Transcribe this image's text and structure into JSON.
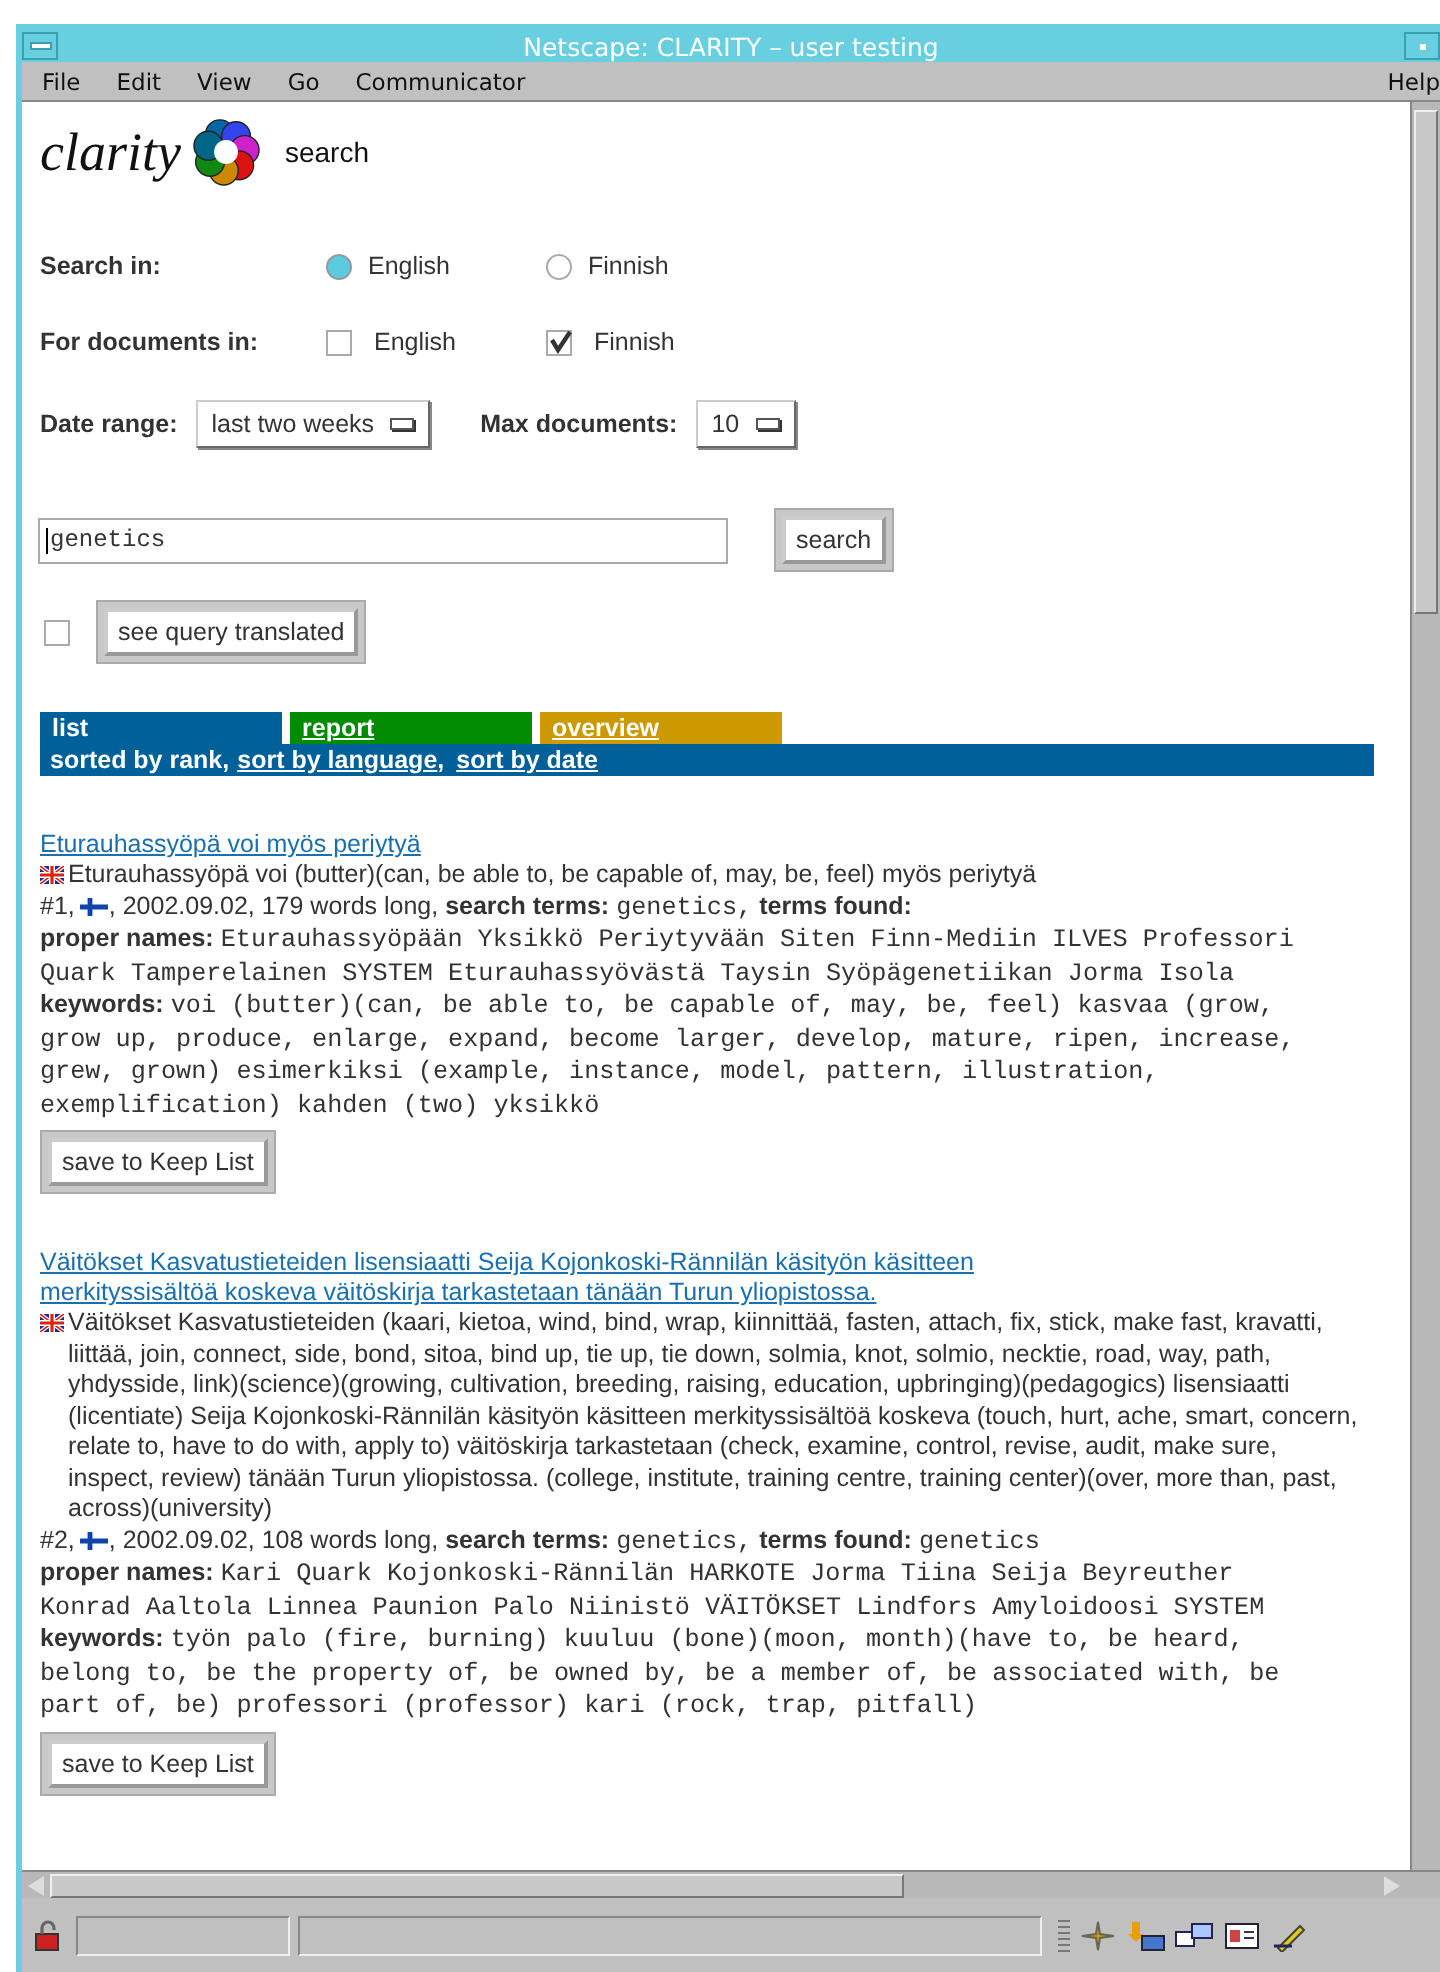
{
  "window": {
    "title": "Netscape: CLARITY – user testing"
  },
  "menu": [
    {
      "label": "File"
    },
    {
      "label": "Edit"
    },
    {
      "label": "View"
    },
    {
      "label": "Go"
    },
    {
      "label": "Communicator"
    }
  ],
  "help_menu": "Help",
  "logo": "clarity",
  "page_title": "search",
  "search_in": {
    "label": "Search in:",
    "options": [
      {
        "label": "English",
        "selected": true
      },
      {
        "label": "Finnish",
        "selected": false
      }
    ]
  },
  "documents_in": {
    "label": "For documents in:",
    "options": [
      {
        "label": "English",
        "checked": false
      },
      {
        "label": "Finnish",
        "checked": true
      }
    ]
  },
  "date_range": {
    "label": "Date range:",
    "value": "last two weeks"
  },
  "max_documents": {
    "label": "Max documents:",
    "value": "10"
  },
  "query": {
    "value": "genetics",
    "button": "search"
  },
  "translate": {
    "checked": false,
    "button": "see query translated"
  },
  "view_tabs": [
    {
      "label": "list",
      "selected": true,
      "color": "#00609a"
    },
    {
      "label": "report",
      "selected": false,
      "color": "#008c00"
    },
    {
      "label": "overview",
      "selected": false,
      "color": "#cc9a00"
    }
  ],
  "sort": [
    {
      "label": "sorted by rank,",
      "selected": true
    },
    {
      "label": "sort by language",
      "selected": false,
      "suffix": ","
    },
    {
      "label": "sort by date",
      "selected": false
    }
  ],
  "results": [
    {
      "title": "Eturauhassyöpä voi myös periytyä",
      "translation": "Eturauhassyöpä voi (butter)(can, be able to, be capable of, may, be, feel) myös periytyä",
      "rank": "#1,",
      "info": ", 2002.09.02, 179 words long,",
      "search_terms_label": "search terms:",
      "search_terms": "genetics,",
      "terms_found_label": "terms found:",
      "proper_names_label": "proper names:",
      "proper_names": "Eturauhassyöpään Yksikkö Periytyvään Siten Finn-Mediin ILVES Professori Quark Tamperelainen SYSTEM Eturauhassyövästä Taysin Syöpägenetiikan Jorma Isola",
      "keywords_label": "keywords:",
      "keywords": "voi (butter)(can, be able to, be capable of, may, be, feel) kasvaa (grow, grow up, produce, enlarge, expand, become larger, develop, mature, ripen, increase, grew, grown) esimerkiksi (example, instance, model, pattern, illustration, exemplification) kahden (two) yksikkö",
      "button": "save to Keep List"
    },
    {
      "title": "Väitökset Kasvatustieteiden lisensiaatti Seija Kojonkoski-Rännilän käsityön käsitteen merkityssisältöä koskeva väitöskirja tarkastetaan tänään Turun yliopistossa.",
      "translation": "Väitökset Kasvatustieteiden (kaari, kietoa, wind, bind, wrap, kiinnittää, fasten, attach, fix, stick, make fast, kravatti, liittää, join, connect, side, bond, sitoa, bind up, tie up, tie down, solmia, knot, solmio, necktie, road, way, path, yhdysside, link)(science)(growing, cultivation, breeding, raising, education, upbringing)(pedagogics) lisensiaatti (licentiate) Seija Kojonkoski-Rännilän käsityön käsitteen merkityssisältöä koskeva (touch, hurt, ache, smart, concern, relate to, have to do with, apply to) väitöskirja tarkastetaan (check, examine, control, revise, audit, make sure, inspect, review) tänään Turun yliopistossa. (college, institute, training centre, training center)(over, more than, past, across)(university)",
      "rank": "#2,",
      "info": ", 2002.09.02, 108 words long,",
      "search_terms_label": "search terms:",
      "search_terms": "genetics,",
      "terms_found_label": "terms found:",
      "terms_found": "genetics",
      "proper_names_label": "proper names:",
      "proper_names": "Kari Quark Kojonkoski-Rännilän HARKOTE Jorma Tiina Seija Beyreuther Konrad Aaltola Linnea Paunion Palo Niinistö VÄITÖKSET Lindfors Amyloidoosi SYSTEM",
      "keywords_label": "keywords:",
      "keywords": "työn palo (fire, burning) kuuluu (bone)(moon, month)(have to, be heard, belong to, be the property of, be owned by, be a member of, be associated with, be part of, be) professori (professor) kari (rock, trap, pitfall)",
      "button": "save to Keep List"
    }
  ]
}
